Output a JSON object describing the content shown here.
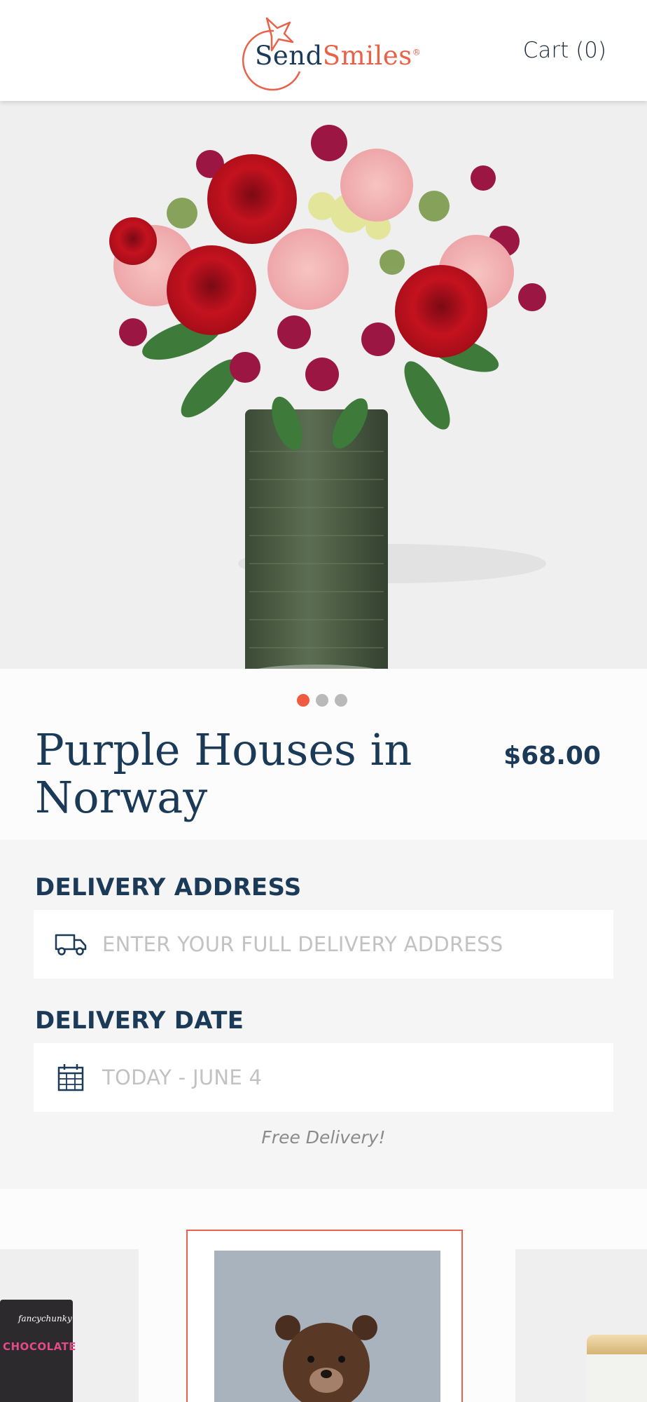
{
  "brand": {
    "name_part1": "Send",
    "name_part2": "Smiles",
    "trademark": "®"
  },
  "header": {
    "cart_label": "Cart (0)"
  },
  "gallery": {
    "slide_count": 3,
    "active_index": 0
  },
  "product": {
    "title": "Purple Houses in Norway",
    "price": "$68.00"
  },
  "delivery": {
    "address_label": "DELIVERY ADDRESS",
    "address_placeholder": "ENTER YOUR FULL DELIVERY ADDRESS",
    "date_label": "DELIVERY DATE",
    "date_value": "TODAY - JUNE 4",
    "note": "Free Delivery!"
  },
  "addons": {
    "left_card_brand": "fancychunky",
    "left_card_label": "CHOCOLATE"
  },
  "colors": {
    "accent": "#e8624a",
    "navy": "#1b3a57",
    "dot_active": "#ef5a40"
  },
  "icons": {
    "address": "truck-icon",
    "date": "calendar-icon"
  }
}
